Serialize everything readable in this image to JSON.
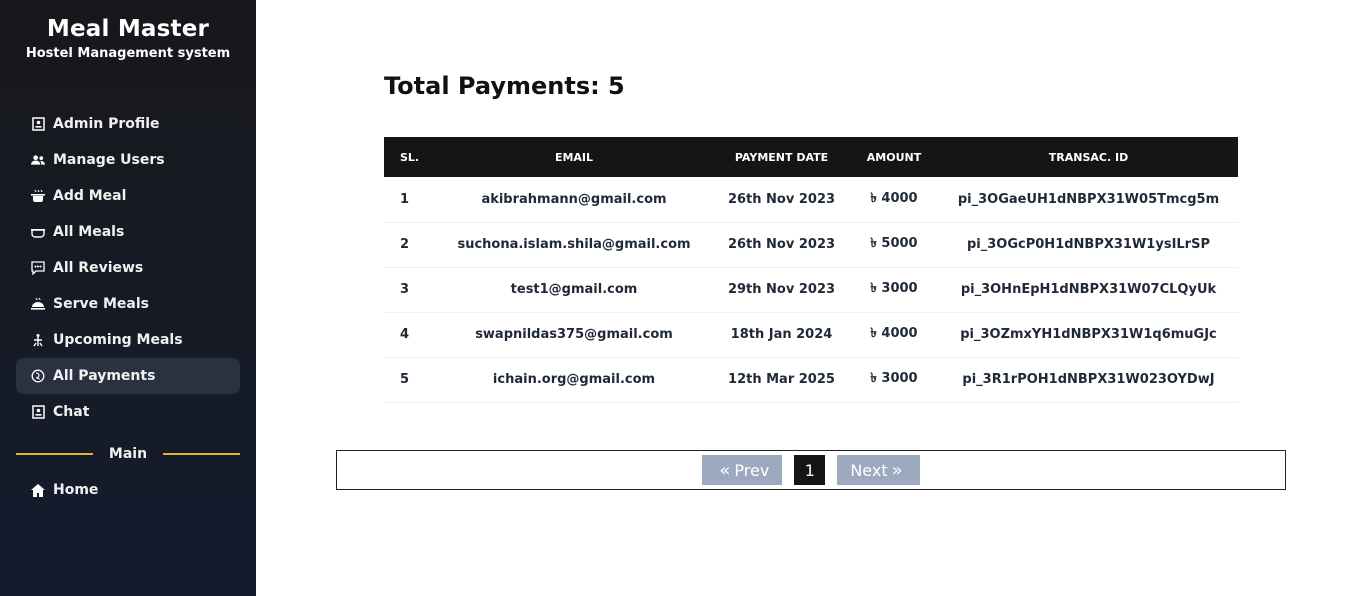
{
  "brand": {
    "title": "Meal Master",
    "subtitle": "Hostel Management system"
  },
  "sidebar": {
    "items": [
      {
        "label": "Admin Profile",
        "icon": "profile-icon"
      },
      {
        "label": "Manage Users",
        "icon": "users-icon"
      },
      {
        "label": "Add Meal",
        "icon": "cooking-pot-icon"
      },
      {
        "label": "All Meals",
        "icon": "bowl-icon"
      },
      {
        "label": "All Reviews",
        "icon": "review-icon"
      },
      {
        "label": "Serve Meals",
        "icon": "serve-icon"
      },
      {
        "label": "Upcoming Meals",
        "icon": "upcoming-icon"
      },
      {
        "label": "All Payments",
        "icon": "payment-icon",
        "active": true
      },
      {
        "label": "Chat",
        "icon": "chat-icon"
      }
    ],
    "divider_label": "Main",
    "home_label": "Home"
  },
  "main": {
    "title": "Total Payments: 5",
    "table": {
      "headers": [
        "SL.",
        "EMAIL",
        "PAYMENT DATE",
        "AMOUNT",
        "TRANSAC. ID"
      ],
      "rows": [
        {
          "sl": "1",
          "email": "akibrahmann@gmail.com",
          "date": "26th Nov 2023",
          "amount": "৳ 4000",
          "txid": "pi_3OGaeUH1dNBPX31W05Tmcg5m"
        },
        {
          "sl": "2",
          "email": "suchona.islam.shila@gmail.com",
          "date": "26th Nov 2023",
          "amount": "৳ 5000",
          "txid": "pi_3OGcP0H1dNBPX31W1ysILrSP"
        },
        {
          "sl": "3",
          "email": "test1@gmail.com",
          "date": "29th Nov 2023",
          "amount": "৳ 3000",
          "txid": "pi_3OHnEpH1dNBPX31W07CLQyUk"
        },
        {
          "sl": "4",
          "email": "swapnildas375@gmail.com",
          "date": "18th Jan 2024",
          "amount": "৳ 4000",
          "txid": "pi_3OZmxYH1dNBPX31W1q6muGJc"
        },
        {
          "sl": "5",
          "email": "ichain.org@gmail.com",
          "date": "12th Mar 2025",
          "amount": "৳ 3000",
          "txid": "pi_3R1rPOH1dNBPX31W023OYDwJ"
        }
      ]
    },
    "pagination": {
      "prev_label": "Prev",
      "current_page": "1",
      "next_label": "Next"
    }
  },
  "colors": {
    "accent_divider": "#e6b422",
    "header_bg": "#151515",
    "pager_btn": "#9ca9bf"
  }
}
